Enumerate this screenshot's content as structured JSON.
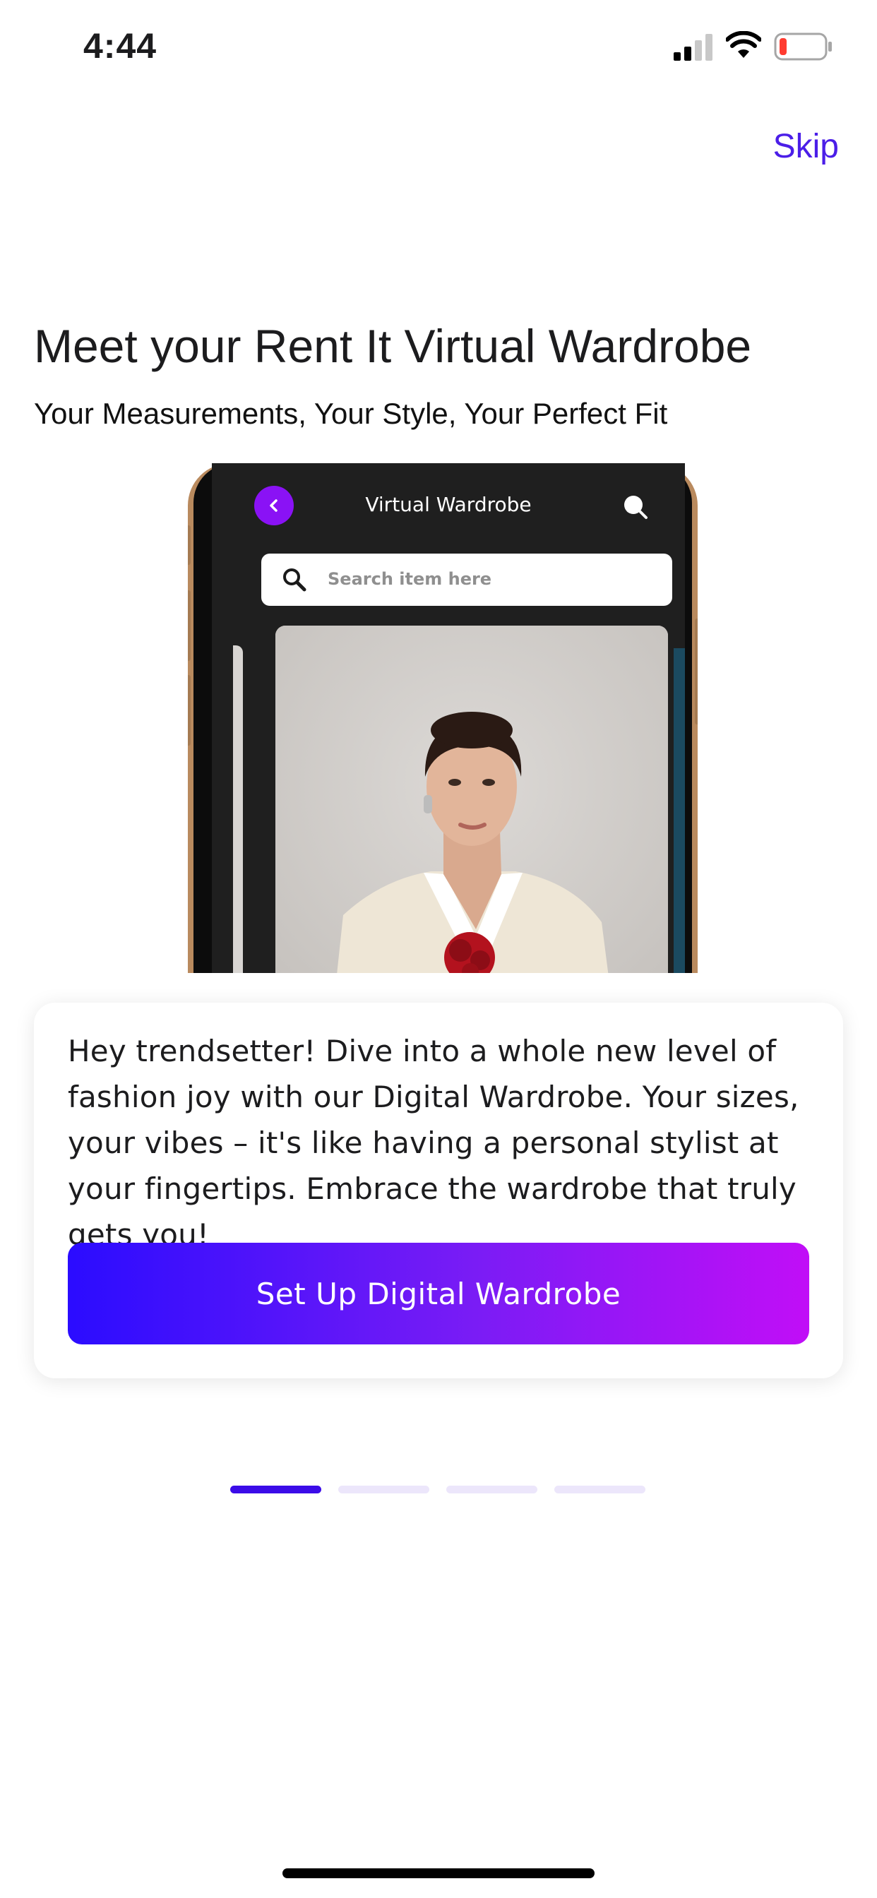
{
  "status_bar": {
    "time": "4:44",
    "icons": [
      "signal-icon",
      "wifi-icon",
      "battery-icon"
    ]
  },
  "header": {
    "skip_label": "Skip"
  },
  "intro": {
    "title": "Meet your Rent It Virtual Wardrobe",
    "subtitle": "Your Measurements, Your Style, Your Perfect Fit"
  },
  "mockup": {
    "screen_title": "Virtual Wardrobe",
    "search_placeholder": "Search item here",
    "icons": [
      "back-chevron-icon",
      "search-icon"
    ]
  },
  "card": {
    "body": "Hey trendsetter! Dive into a whole new level of fashion joy with our Digital Wardrobe. Your sizes, your vibes – it's like having a personal stylist at your fingertips. Embrace the wardrobe that truly gets you!",
    "cta_label": "Set Up Digital Wardrobe"
  },
  "pager": {
    "total": 4,
    "active_index": 0
  },
  "colors": {
    "accent": "#4b1ee8",
    "gradient_start": "#2b0cff",
    "gradient_end": "#c10ef7",
    "pager_active": "#3b0ce8",
    "pager_inactive": "#ece6fb",
    "mock_back_button": "#8a12f5"
  }
}
